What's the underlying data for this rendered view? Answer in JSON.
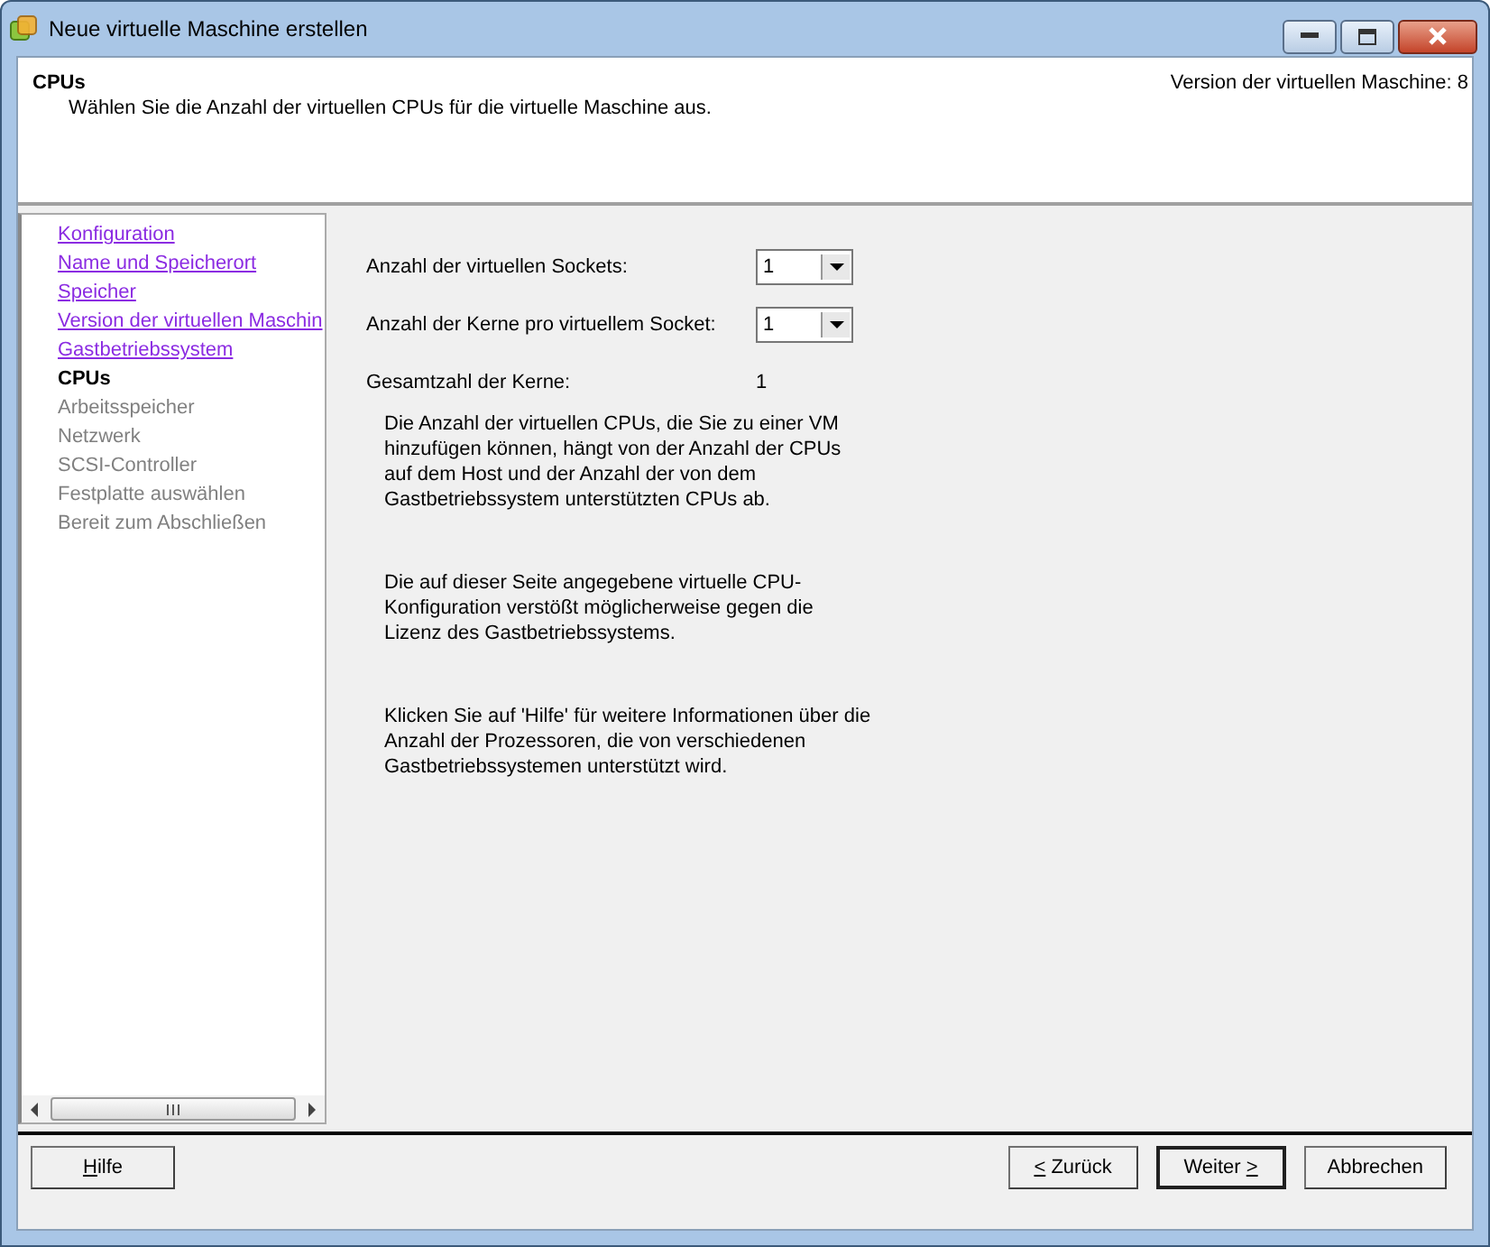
{
  "window": {
    "title": "Neue virtuelle Maschine erstellen"
  },
  "header": {
    "title": "CPUs",
    "subtitle": "Wählen Sie die Anzahl der virtuellen CPUs für die virtuelle Maschine aus.",
    "version": "Version der virtuellen Maschine: 8"
  },
  "steps": [
    {
      "label": "Konfiguration",
      "kind": "done"
    },
    {
      "label": "Name und Speicherort",
      "kind": "done"
    },
    {
      "label": "Speicher",
      "kind": "done"
    },
    {
      "label": "Version der virtuellen Maschin",
      "kind": "done"
    },
    {
      "label": "Gastbetriebssystem",
      "kind": "done"
    },
    {
      "label": "CPUs",
      "kind": "current"
    },
    {
      "label": "Arbeitsspeicher",
      "kind": "pending"
    },
    {
      "label": "Netzwerk",
      "kind": "pending"
    },
    {
      "label": "SCSI-Controller",
      "kind": "pending"
    },
    {
      "label": "Festplatte auswählen",
      "kind": "pending"
    },
    {
      "label": "Bereit zum Abschließen",
      "kind": "pending"
    }
  ],
  "form": [
    {
      "label": "Anzahl der virtuellen Sockets:",
      "kind": "select",
      "value": "1"
    },
    {
      "label": "Anzahl der Kerne pro virtuellem Socket:",
      "kind": "select",
      "value": "1"
    },
    {
      "label": "Gesamtzahl der Kerne:",
      "kind": "text",
      "value": "1"
    }
  ],
  "notes": [
    "Die Anzahl der virtuellen CPUs, die Sie zu einer VM hinzufügen können, hängt von der Anzahl der CPUs auf dem Host und der Anzahl der von dem Gastbetriebssystem unterstützten CPUs ab.",
    "Die auf dieser Seite angegebene virtuelle CPU-Konfiguration verstößt möglicherweise gegen die Lizenz des Gastbetriebssystems.",
    "Klicken Sie auf 'Hilfe' für weitere Informationen über die Anzahl der Prozessoren, die von verschiedenen Gastbetriebssystemen unterstützt wird."
  ],
  "buttons": [
    {
      "key": "H",
      "post": "ilfe",
      "kind": "help",
      "default": false
    },
    {
      "key": "<",
      "post": " Zurück",
      "kind": "nav",
      "default": false
    },
    {
      "pre": "Weiter ",
      "key": ">",
      "kind": "nav",
      "default": true
    },
    {
      "pre": "Abbrechen",
      "kind": "nav",
      "default": false
    }
  ]
}
